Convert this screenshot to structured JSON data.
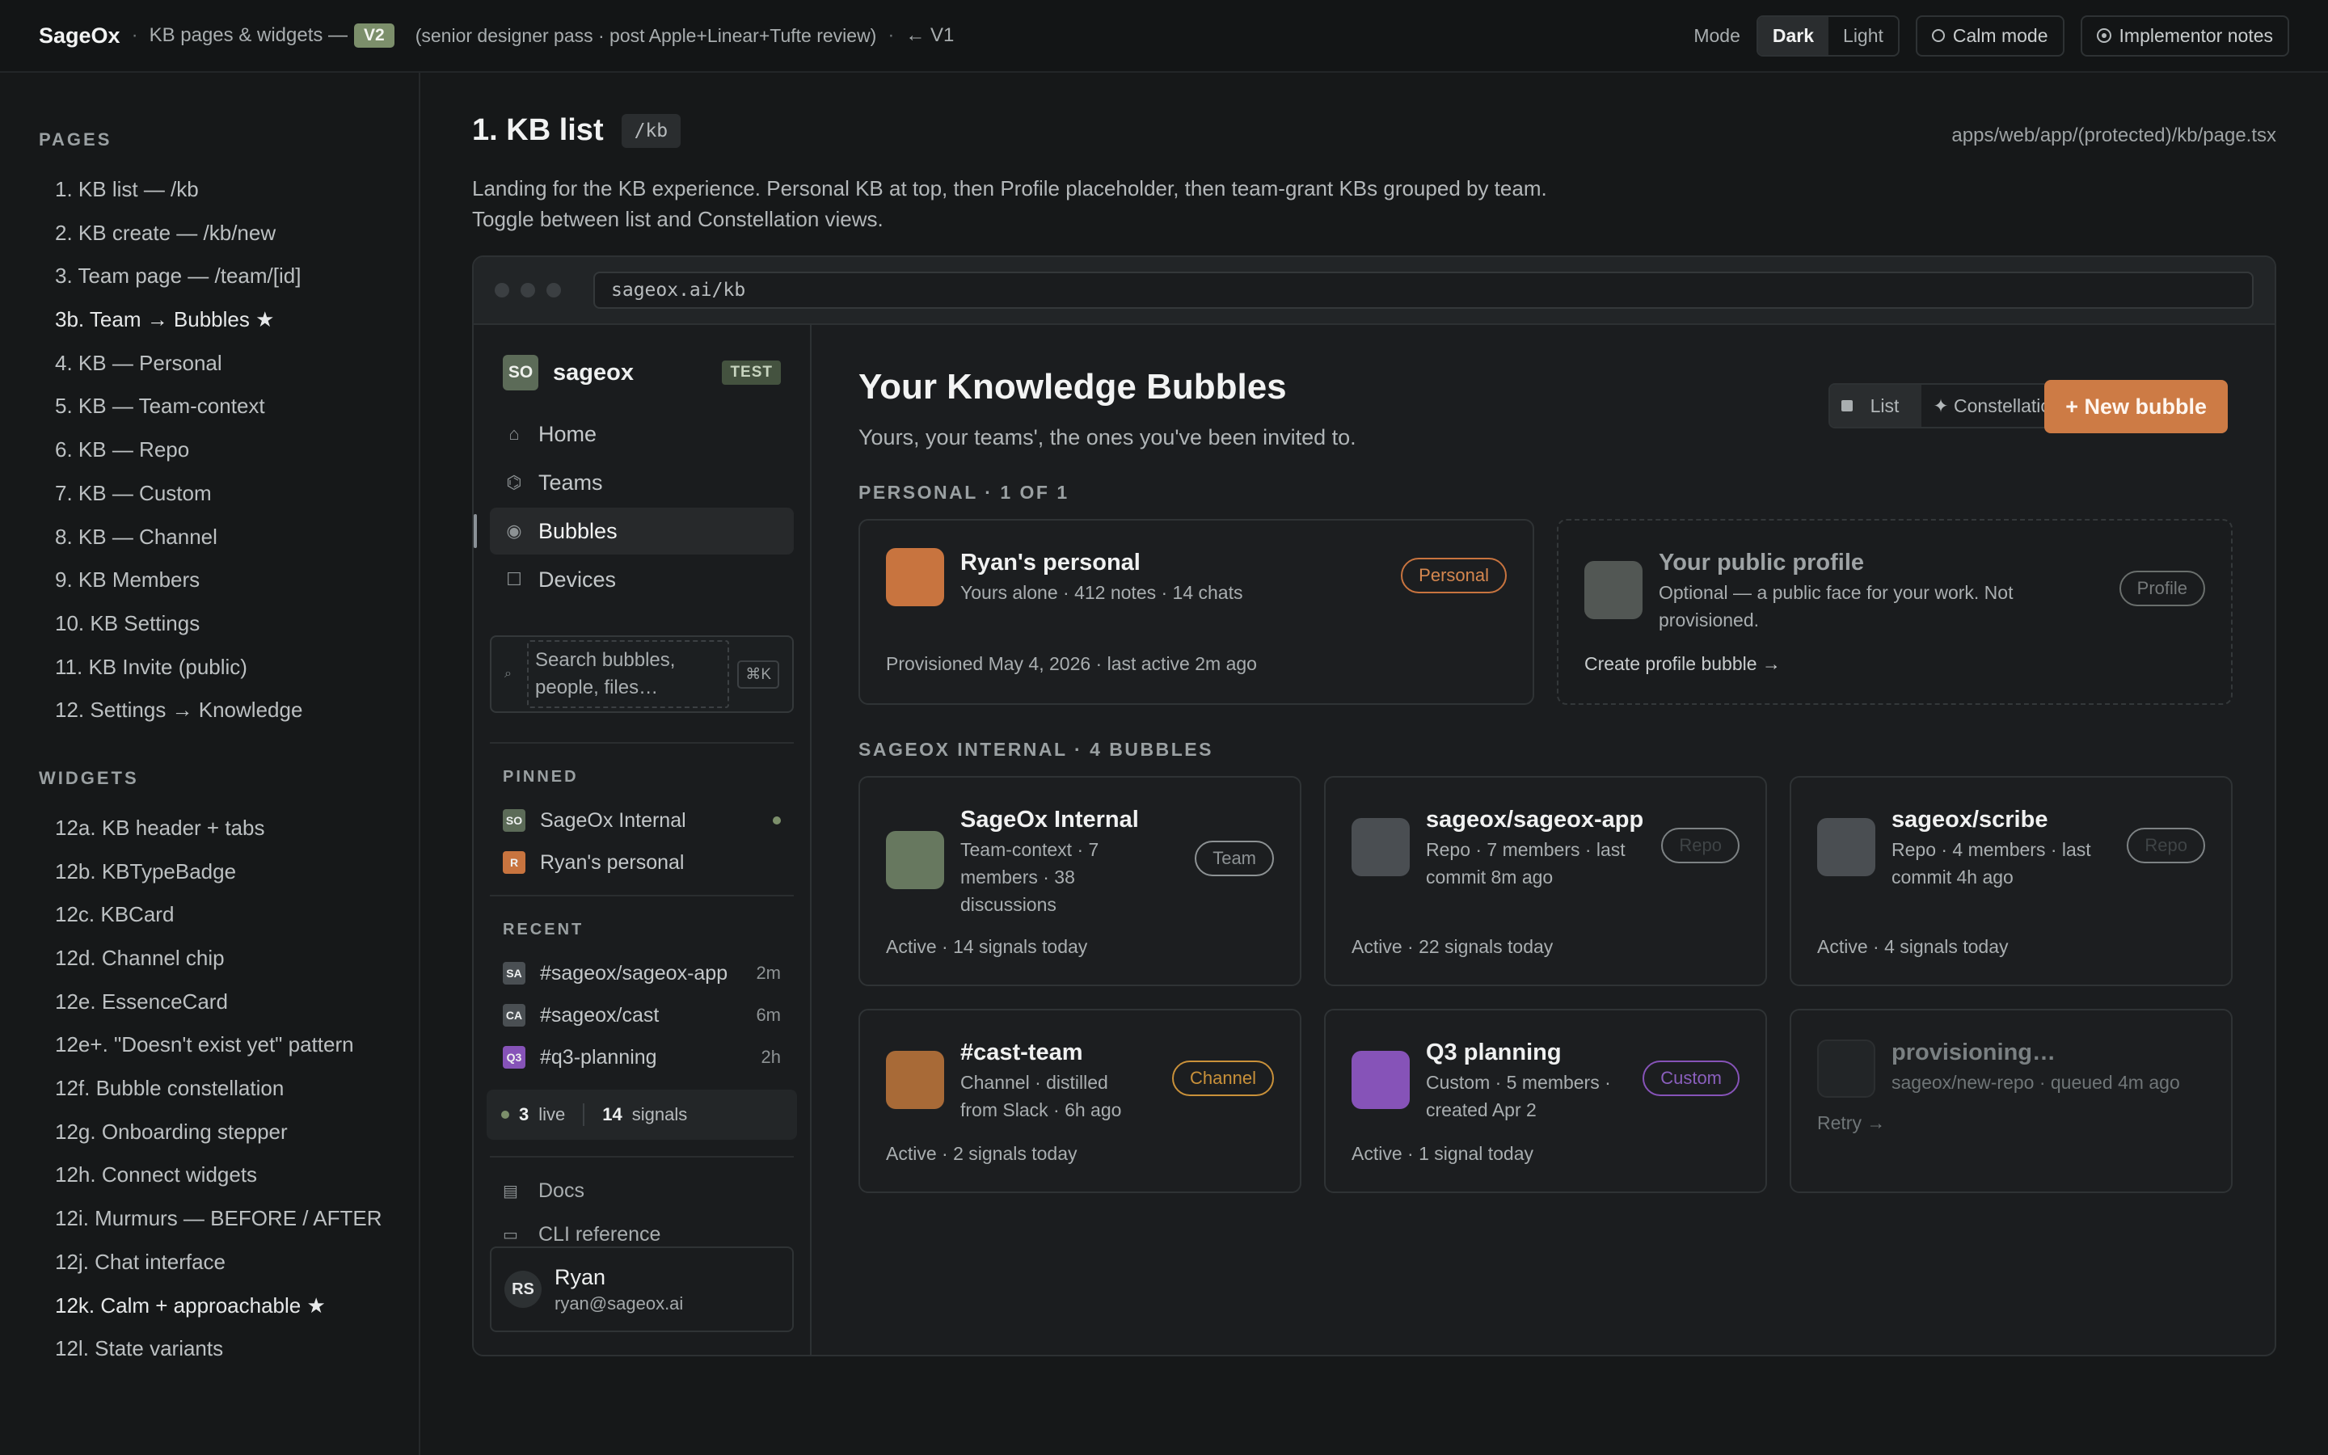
{
  "topbar": {
    "brand": "SageOx",
    "sep": "·",
    "section": "KB pages & widgets —",
    "version": "V2",
    "note": "(senior designer pass · post Apple+Linear+Tufte review)",
    "back": "← V1",
    "mode_label": "Mode",
    "mode_dark": "Dark",
    "mode_light": "Light",
    "calm": "Calm mode",
    "notes": "Implementor notes"
  },
  "docnav": {
    "pages_label": "PAGES",
    "pages": [
      "1. KB list — /kb",
      "2. KB create — /kb/new",
      "3. Team page — /team/[id]",
      "3b. Team → Bubbles ★",
      "4. KB — Personal",
      "5. KB — Team-context",
      "6. KB — Repo",
      "7. KB — Custom",
      "8. KB — Channel",
      "9. KB Members",
      "10. KB Settings",
      "11. KB Invite (public)",
      "12. Settings → Knowledge"
    ],
    "widgets_label": "WIDGETS",
    "widgets": [
      "12a. KB header + tabs",
      "12b. KBTypeBadge",
      "12c. KBCard",
      "12d. Channel chip",
      "12e. EssenceCard",
      "12e+. \"Doesn't exist yet\" pattern",
      "12f. Bubble constellation",
      "12g. Onboarding stepper",
      "12h. Connect widgets",
      "12i. Murmurs — BEFORE / AFTER",
      "12j. Chat interface",
      "12k. Calm + approachable ★",
      "12l. State variants"
    ]
  },
  "page": {
    "title": "1. KB list",
    "route": "/kb",
    "file": "apps/web/app/(protected)/kb/page.tsx",
    "desc1": "Landing for the KB experience. Personal KB at top, then Profile placeholder, then team-grant KBs grouped by team.",
    "desc2": "Toggle between list and Constellation views."
  },
  "browser": {
    "url": "sageox.ai/kb"
  },
  "app": {
    "workspace": {
      "avatar": "SO",
      "name": "sageox",
      "badge": "TEST"
    },
    "nav": [
      {
        "icon": "home-icon",
        "glyph": "⌂",
        "label": "Home"
      },
      {
        "icon": "teams-icon",
        "glyph": "⌬",
        "label": "Teams"
      },
      {
        "icon": "bubbles-icon",
        "glyph": "◉",
        "label": "Bubbles"
      },
      {
        "icon": "devices-icon",
        "glyph": "☐",
        "label": "Devices"
      }
    ],
    "search": {
      "icon": "search-icon",
      "placeholder_1": "Search bubbles,",
      "placeholder_2": "people, files…",
      "kbd": "⌘K"
    },
    "pinned_label": "PINNED",
    "pinned": [
      {
        "chip": "SO",
        "color": "#5c6b58",
        "label": "SageOx Internal"
      },
      {
        "chip": "R",
        "color": "#c8743f",
        "label": "Ryan's personal"
      }
    ],
    "recent_label": "RECENT",
    "recent": [
      {
        "chip": "SA",
        "color": "#4a4f53",
        "label": "#sageox/sageox-app",
        "ago": "2m"
      },
      {
        "chip": "CA",
        "color": "#4a4f53",
        "label": "#sageox/cast",
        "ago": "6m"
      },
      {
        "chip": "Q3",
        "color": "#8653b8",
        "label": "#q3-planning",
        "ago": "2h"
      }
    ],
    "stats": {
      "live_n": "3",
      "live_label": "live",
      "signals_n": "14",
      "signals_label": "signals"
    },
    "footer_links": [
      {
        "icon": "book-icon",
        "glyph": "📖",
        "label": "Docs"
      },
      {
        "icon": "terminal-icon",
        "glyph": "⌨",
        "label": "CLI reference"
      }
    ],
    "user": {
      "initials": "RS",
      "name": "Ryan",
      "email": "ryan@sageox.ai"
    },
    "main": {
      "title": "Your Knowledge Bubbles",
      "subtitle": "Yours, your teams', the ones you've been invited to.",
      "view_list": "List",
      "view_constellation": "✦ Constellation",
      "new_button": "+ New bubble",
      "personal_label": "PERSONAL · 1 OF 1",
      "team_label": "SAGEOX INTERNAL · 4 BUBBLES",
      "cards": {
        "personal": {
          "title": "Ryan's personal",
          "meta": "Yours alone · 412 notes · 14 chats",
          "tag": "Personal",
          "foot": "Provisioned May 4, 2026 · last active 2m ago",
          "color": "#c8743f"
        },
        "profile": {
          "title": "Your public profile",
          "meta1": "Optional — a public face for your work. Not",
          "meta2": "provisioned.",
          "tag": "Profile",
          "foot": "Create profile bubble →",
          "color": "#525754"
        },
        "internal": {
          "title": "SageOx Internal",
          "meta1": "Team-context · 7",
          "meta2": "members · 38",
          "meta3": "discussions",
          "tag": "Team",
          "foot": "Active · 14 signals today",
          "color": "#67785f"
        },
        "app": {
          "title": "sageox/sageox-app",
          "meta1": "Repo · 7 members · last",
          "meta2": "commit 8m ago",
          "tag": "Repo",
          "foot": "Active · 22 signals today",
          "color": "#4a4e52"
        },
        "scribe": {
          "title": "sageox/scribe",
          "meta1": "Repo · 4 members · last",
          "meta2": "commit 4h ago",
          "tag": "Repo",
          "foot": "Active · 4 signals today",
          "color": "#4a4e52"
        },
        "cast": {
          "title": "#cast-team",
          "meta1": "Channel · distilled",
          "meta2": "from Slack · 6h ago",
          "tag": "Channel",
          "foot": "Active · 2 signals today",
          "color": "#a86a37"
        },
        "q3": {
          "title": "Q3 planning",
          "meta1": "Custom · 5 members ·",
          "meta2": "created Apr 2",
          "tag": "Custom",
          "foot": "Active · 1 signal today",
          "color": "#8653b8"
        },
        "prov": {
          "title": "provisioning…",
          "meta": "sageox/new-repo · queued 4m ago",
          "foot": "Retry →",
          "color": "#222527"
        }
      }
    }
  },
  "colors": {
    "accent": "#cd7b45",
    "team_green": "#7c8f6b",
    "channel_amber": "#c9913a",
    "custom_purple": "#8653b8"
  }
}
